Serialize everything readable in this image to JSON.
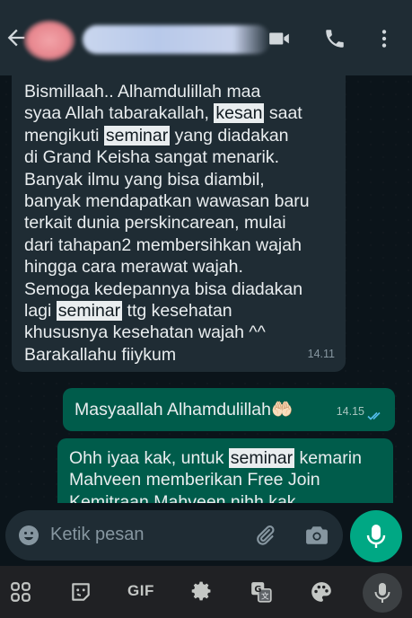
{
  "header": {
    "back_icon": "arrow-left-icon",
    "video_icon": "video-call-icon",
    "phone_icon": "phone-icon",
    "menu_icon": "more-vert-icon"
  },
  "messages": [
    {
      "direction": "incoming",
      "lines": [
        [
          {
            "t": "Bismillaah.. Alhamdulillah maa"
          }
        ],
        [
          {
            "t": "syaa Allah tabarakallah, "
          },
          {
            "t": "kesan",
            "hl": true
          },
          {
            "t": " saat"
          }
        ],
        [
          {
            "t": "mengikuti "
          },
          {
            "t": "seminar",
            "hl": true
          },
          {
            "t": " yang diadakan"
          }
        ],
        [
          {
            "t": "di Grand Keisha sangat menarik."
          }
        ],
        [
          {
            "t": "Banyak ilmu yang bisa diambil,"
          }
        ],
        [
          {
            "t": "banyak mendapatkan wawasan baru"
          }
        ],
        [
          {
            "t": "terkait dunia perskincarean, mulai"
          }
        ],
        [
          {
            "t": "dari tahapan2 membersihkan wajah"
          }
        ],
        [
          {
            "t": "hingga cara merawat wajah."
          }
        ],
        [
          {
            "t": "Semoga kedepannya bisa diadakan"
          }
        ],
        [
          {
            "t": "lagi "
          },
          {
            "t": "seminar",
            "hl": true
          },
          {
            "t": " ttg kesehatan"
          }
        ],
        [
          {
            "t": "khususnya kesehatan wajah ^^"
          }
        ],
        [
          {
            "t": "Barakallahu fiiykum"
          }
        ]
      ],
      "time": "14.11"
    },
    {
      "direction": "outgoing",
      "lines": [
        [
          {
            "t": "Masyaallah Alhamdulillah🤲🏻"
          }
        ]
      ],
      "time": "14.15",
      "status": "read"
    },
    {
      "direction": "outgoing",
      "lines": [
        [
          {
            "t": "Ohh iyaa kak, untuk "
          },
          {
            "t": "seminar",
            "hl": true
          },
          {
            "t": " kemarin"
          }
        ],
        [
          {
            "t": "Mahveen memberikan Free Join"
          }
        ],
        [
          {
            "t": "Kemitraan Mahveen nihh kak"
          }
        ]
      ]
    }
  ],
  "composer": {
    "placeholder": "Ketik pesan",
    "emoji_icon": "emoji-icon",
    "attach_icon": "paperclip-icon",
    "camera_icon": "camera-icon",
    "mic_icon": "mic-icon",
    "accent": "#00a884"
  },
  "keyboard_toolbar": {
    "gif_label": "GIF",
    "items": [
      "apps-grid-icon",
      "sticker-icon",
      "gif",
      "settings-icon",
      "translate-icon",
      "palette-icon",
      "voice-input-icon"
    ]
  }
}
